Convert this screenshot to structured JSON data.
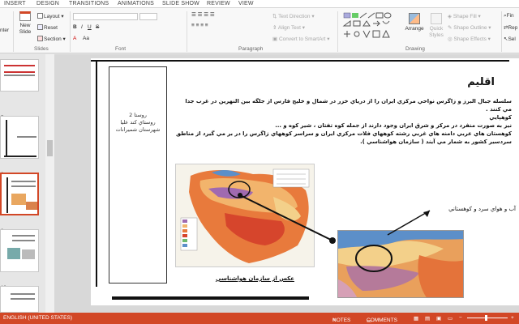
{
  "tabs": [
    "INSERT",
    "DESIGN",
    "TRANSITIONS",
    "ANIMATIONS",
    "SLIDE SHOW",
    "REVIEW",
    "VIEW"
  ],
  "ribbon": {
    "new_slide_label_1": "New",
    "new_slide_label_2": "Slide",
    "layout": "Layout",
    "reset": "Reset",
    "section": "Section",
    "slides_group": "Slides",
    "font_group": "Font",
    "text_direction": "Text Direction",
    "align_text": "Align Text",
    "convert_smartart": "Convert to SmartArt",
    "paragraph_group": "Paragraph",
    "arrange": "Arrange",
    "quick_styles_1": "Quick",
    "quick_styles_2": "Styles",
    "shape_fill": "Shape Fill",
    "shape_outline": "Shape Outline",
    "shape_effects": "Shape Effects",
    "drawing_group": "Drawing",
    "find": "Fin",
    "replace": "Rep",
    "select": "Sel",
    "paste_partial": "nter"
  },
  "thumbnails": [
    {
      "num": ""
    },
    {
      "num": "7"
    },
    {
      "num": "8"
    },
    {
      "num": "9"
    },
    {
      "num": "10"
    }
  ],
  "slide": {
    "title": "اقليم",
    "body_line1": "سلسله جبال البرز و زاگرس نواحي مرکزي ايران را از درياي خزر در شمال و خليج فارس از جلگه بين النهرين در غرب جدا مي کنند .",
    "body_line2": "کوهپايي",
    "body_line3": "نيز به صورت منفرد در مرکز و شرق ايران وجود دارند از جمله کوه تفتان ، شير کوه و ...",
    "body_line4": "کوهستان هاي عربي دامنه هاي غربي رشته کوههاي فلات مرکزي ايران و سراسر کوههاي زاگرس را در بر مي گيرد از مناطق",
    "body_line5": "سردسير کشور به شمار مي آيند ( سازمان هواشناسي ).",
    "box_line1": "روستا 2",
    "box_line2": "روستاي كند عليا",
    "box_line3": "شهرستان شميرانات",
    "caption": "عكس از سازمان هواشناسي",
    "callout": "آب و هواي سرد و كوهستاني"
  },
  "statusbar": {
    "language": "ENGLISH (UNITED STATES)",
    "notes": "NOTES",
    "comments": "COMMENTS"
  },
  "colors": {
    "accent": "#d24726",
    "map_hot": "#e87a3c",
    "map_warm": "#f2b46c",
    "map_cold": "#a06ab0"
  }
}
